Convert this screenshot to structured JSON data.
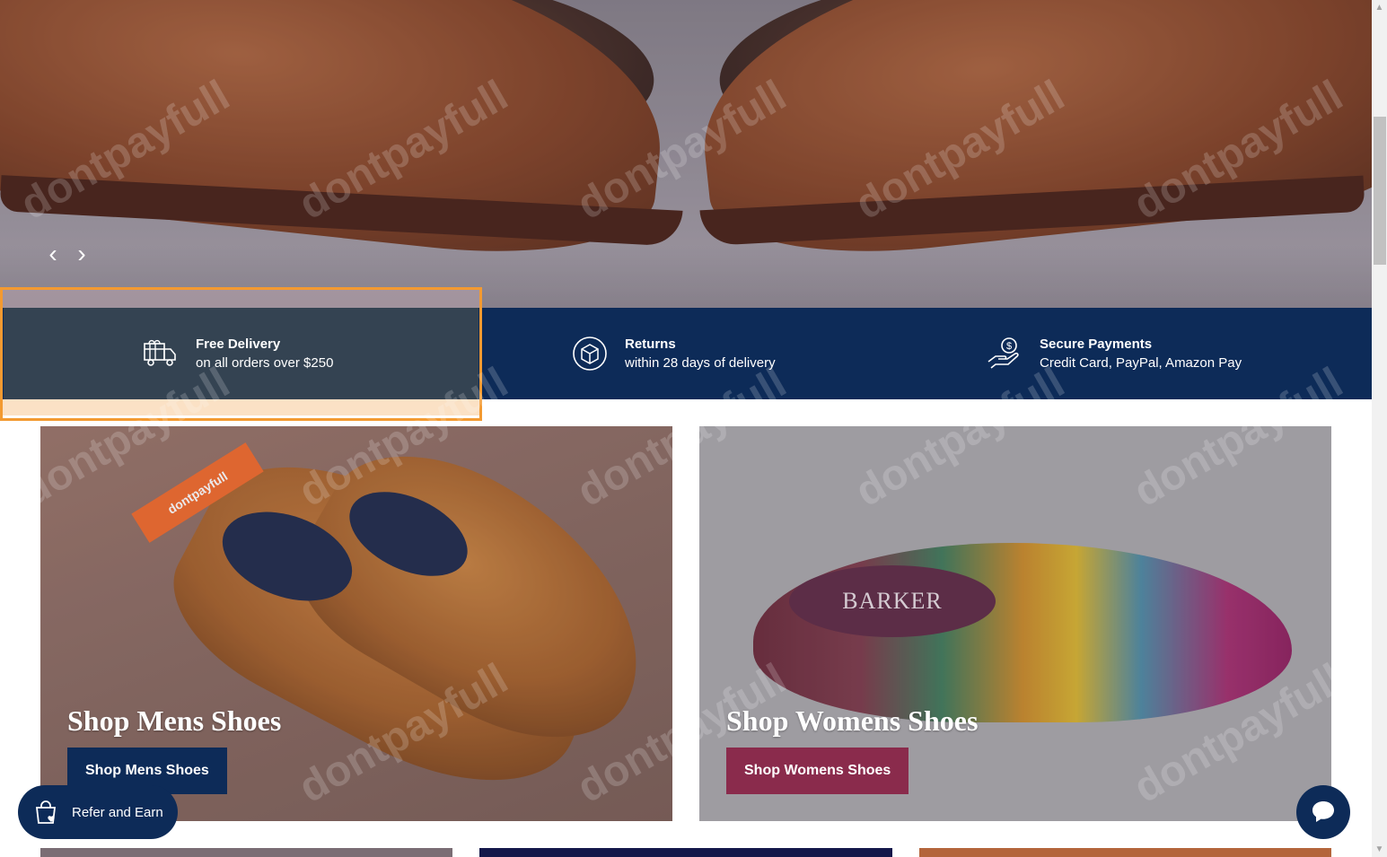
{
  "hero": {
    "prev_label": "‹",
    "next_label": "›"
  },
  "features": [
    {
      "icon": "gift-truck-icon",
      "title": "Free Delivery",
      "subtitle": "on all orders over $250"
    },
    {
      "icon": "returns-box-icon",
      "title": "Returns",
      "subtitle": "within 28 days of delivery"
    },
    {
      "icon": "payment-hand-icon",
      "title": "Secure Payments",
      "subtitle": "Credit Card, PayPal, Amazon Pay"
    }
  ],
  "cards": {
    "men": {
      "title": "Shop Mens Shoes",
      "button": "Shop Mens Shoes",
      "ribbon": "dontpayfull"
    },
    "women": {
      "title": "Shop Womens Shoes",
      "button": "Shop Womens Shoes",
      "shoe_brand": "BARKER"
    }
  },
  "widgets": {
    "refer_label": "Refer and Earn"
  },
  "watermark": "dontpayfull",
  "colors": {
    "navy": "#0d2b58",
    "burgundy": "#8a2b4c",
    "highlight": "#f39a31"
  }
}
